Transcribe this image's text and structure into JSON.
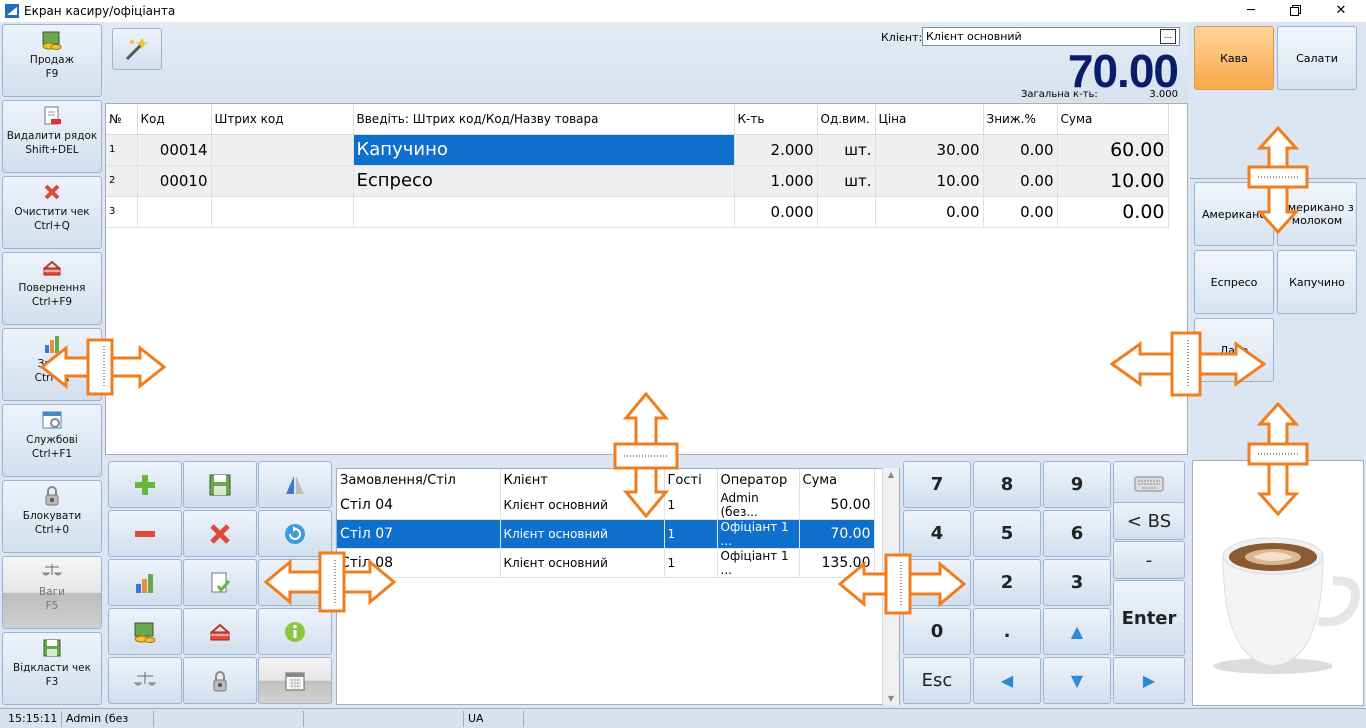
{
  "window": {
    "title": "Екран касиру/офіціанта",
    "maximize_icon": "restore-icon",
    "close_label": "✕"
  },
  "sidebar": {
    "items": [
      {
        "label": "Продаж",
        "shortcut": "F9",
        "icon": "coins-icon"
      },
      {
        "label": "Видалити рядок",
        "shortcut": "Shift+DEL",
        "icon": "delete-doc-icon"
      },
      {
        "label": "Очистити чек",
        "shortcut": "Ctrl+Q",
        "icon": "clear-icon"
      },
      {
        "label": "Повернення",
        "shortcut": "Ctrl+F9",
        "icon": "return-icon"
      },
      {
        "label": "Звіти",
        "shortcut": "Ctrl+R",
        "icon": "reports-icon"
      },
      {
        "label": "Службові",
        "shortcut": "Ctrl+F1",
        "icon": "service-icon"
      },
      {
        "label": "Блокувати",
        "shortcut": "Ctrl+0",
        "icon": "lock-icon"
      },
      {
        "label": "Ваги",
        "shortcut": "F5",
        "icon": "scales-icon"
      },
      {
        "label": "Відкласти чек",
        "shortcut": "F3",
        "icon": "save-icon"
      }
    ]
  },
  "header": {
    "client_label": "Клієнт:",
    "client_value": "Клієнт основний",
    "client_btn": "...",
    "total": "70.00",
    "qty_label": "Загальна к-ть:",
    "qty_value": "3.000"
  },
  "grid": {
    "columns": [
      "№",
      "Код",
      "Штрих код",
      "Введіть: Штрих код/Код/Назву товара",
      "К-ть",
      "Од.вим.",
      "Ціна",
      "Зниж.%",
      "Сума"
    ],
    "rows": [
      {
        "no": "1",
        "code": "00014",
        "barcode": "",
        "name": "Капучино",
        "qty": "2.000",
        "unit": "шт.",
        "price": "30.00",
        "disc": "0.00",
        "sum": "60.00"
      },
      {
        "no": "2",
        "code": "00010",
        "barcode": "",
        "name": "Еспресо",
        "qty": "1.000",
        "unit": "шт.",
        "price": "10.00",
        "disc": "0.00",
        "sum": "10.00"
      },
      {
        "no": "3",
        "code": "",
        "barcode": "",
        "name": "",
        "qty": "0.000",
        "unit": "",
        "price": "0.00",
        "disc": "0.00",
        "sum": "0.00"
      }
    ]
  },
  "orders": {
    "columns": [
      "Замовлення/Стіл",
      "Клієнт",
      "Гості",
      "Оператор",
      "Сума"
    ],
    "rows": [
      {
        "table": "Стіл 04",
        "client": "Клієнт основний",
        "guests": "1",
        "operator": "Admin (без...",
        "sum": "50.00"
      },
      {
        "table": "Стіл 07",
        "client": "Клієнт основний",
        "guests": "1",
        "operator": "Офіціант 1 ...",
        "sum": "70.00"
      },
      {
        "table": "Стіл 08",
        "client": "Клієнт основний",
        "guests": "1",
        "operator": "Офіціант 1 ...",
        "sum": "135.00"
      }
    ]
  },
  "numpad": {
    "keys": [
      "7",
      "8",
      "9",
      "4",
      "5",
      "6",
      "1",
      "2",
      "3",
      "0",
      "."
    ],
    "esc": "Esc",
    "bs": "< BS",
    "minus": "-",
    "enter": "Enter",
    "keyboard_icon": "keyboard-icon"
  },
  "categories": {
    "top": [
      {
        "label": "Кава",
        "active": true
      },
      {
        "label": "Салати",
        "active": false
      }
    ],
    "items": [
      "Американо",
      "Американо з молоком",
      "Еспресо",
      "Капучино",
      "Лате"
    ]
  },
  "status": {
    "time": "15:15:11",
    "user": "Admin (без",
    "lang": "UA"
  },
  "colors": {
    "accent": "#0f6fcd",
    "total": "#0b1c6a",
    "arrow": "#f07d1e",
    "active_cat": "#f7a94a"
  }
}
